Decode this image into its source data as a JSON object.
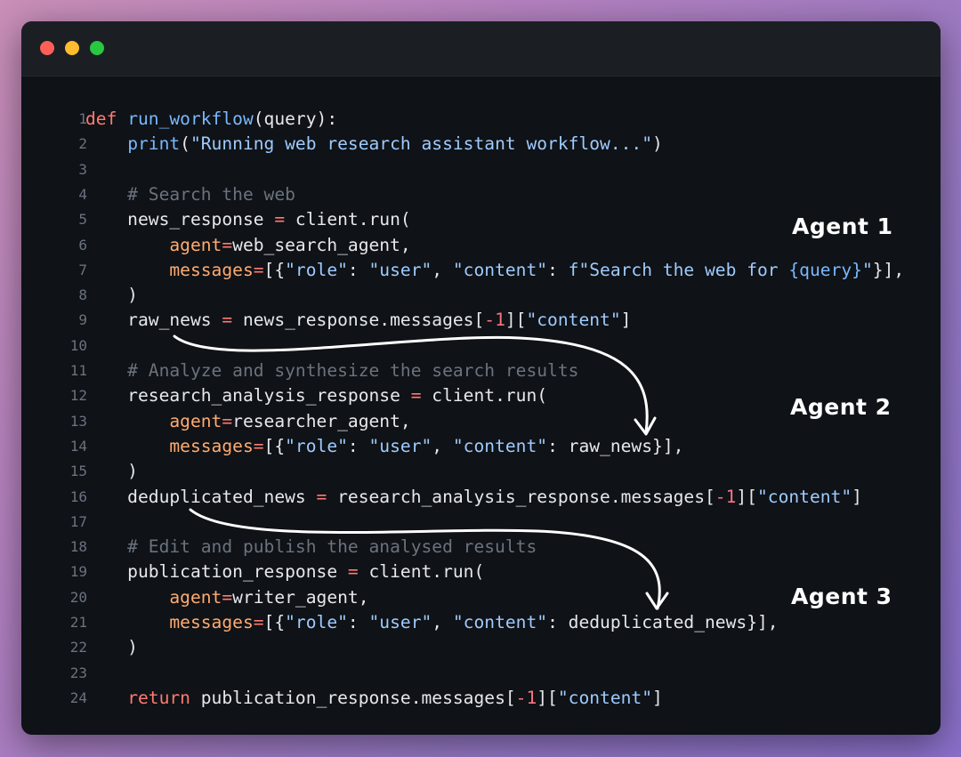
{
  "window": {
    "controls": [
      "close",
      "minimize",
      "maximize"
    ]
  },
  "code_lines": [
    [
      {
        "t": "def ",
        "c": "kw"
      },
      {
        "t": "run_workflow",
        "c": "fn"
      },
      {
        "t": "(query):",
        "c": "pl"
      }
    ],
    [
      {
        "t": "    ",
        "c": "pl"
      },
      {
        "t": "print",
        "c": "fn"
      },
      {
        "t": "(",
        "c": "pl"
      },
      {
        "t": "\"Running web research assistant workflow...\"",
        "c": "str"
      },
      {
        "t": ")",
        "c": "pl"
      }
    ],
    [],
    [
      {
        "t": "    # Search the web",
        "c": "com"
      }
    ],
    [
      {
        "t": "    news_response ",
        "c": "pl"
      },
      {
        "t": "=",
        "c": "op"
      },
      {
        "t": " client.run(",
        "c": "pl"
      }
    ],
    [
      {
        "t": "        ",
        "c": "pl"
      },
      {
        "t": "agent",
        "c": "arg"
      },
      {
        "t": "=",
        "c": "op"
      },
      {
        "t": "web_search_agent,",
        "c": "pl"
      }
    ],
    [
      {
        "t": "        ",
        "c": "pl"
      },
      {
        "t": "messages",
        "c": "arg"
      },
      {
        "t": "=",
        "c": "op"
      },
      {
        "t": "[{",
        "c": "pl"
      },
      {
        "t": "\"role\"",
        "c": "str"
      },
      {
        "t": ": ",
        "c": "pl"
      },
      {
        "t": "\"user\"",
        "c": "str"
      },
      {
        "t": ", ",
        "c": "pl"
      },
      {
        "t": "\"content\"",
        "c": "str"
      },
      {
        "t": ": ",
        "c": "pl"
      },
      {
        "t": "f\"Search the web for ",
        "c": "str"
      },
      {
        "t": "{query}",
        "c": "fn"
      },
      {
        "t": "\"",
        "c": "str"
      },
      {
        "t": "}],",
        "c": "pl"
      }
    ],
    [
      {
        "t": "    )",
        "c": "pl"
      }
    ],
    [
      {
        "t": "    raw_news ",
        "c": "pl"
      },
      {
        "t": "=",
        "c": "op"
      },
      {
        "t": " news_response.messages[",
        "c": "pl"
      },
      {
        "t": "-1",
        "c": "num"
      },
      {
        "t": "][",
        "c": "pl"
      },
      {
        "t": "\"content\"",
        "c": "str"
      },
      {
        "t": "]",
        "c": "pl"
      }
    ],
    [],
    [
      {
        "t": "    # Analyze and synthesize the search results",
        "c": "com"
      }
    ],
    [
      {
        "t": "    research_analysis_response ",
        "c": "pl"
      },
      {
        "t": "=",
        "c": "op"
      },
      {
        "t": " client.run(",
        "c": "pl"
      }
    ],
    [
      {
        "t": "        ",
        "c": "pl"
      },
      {
        "t": "agent",
        "c": "arg"
      },
      {
        "t": "=",
        "c": "op"
      },
      {
        "t": "researcher_agent,",
        "c": "pl"
      }
    ],
    [
      {
        "t": "        ",
        "c": "pl"
      },
      {
        "t": "messages",
        "c": "arg"
      },
      {
        "t": "=",
        "c": "op"
      },
      {
        "t": "[{",
        "c": "pl"
      },
      {
        "t": "\"role\"",
        "c": "str"
      },
      {
        "t": ": ",
        "c": "pl"
      },
      {
        "t": "\"user\"",
        "c": "str"
      },
      {
        "t": ", ",
        "c": "pl"
      },
      {
        "t": "\"content\"",
        "c": "str"
      },
      {
        "t": ": raw_news}],",
        "c": "pl"
      }
    ],
    [
      {
        "t": "    )",
        "c": "pl"
      }
    ],
    [
      {
        "t": "    deduplicated_news ",
        "c": "pl"
      },
      {
        "t": "=",
        "c": "op"
      },
      {
        "t": " research_analysis_response.messages[",
        "c": "pl"
      },
      {
        "t": "-1",
        "c": "num"
      },
      {
        "t": "][",
        "c": "pl"
      },
      {
        "t": "\"content\"",
        "c": "str"
      },
      {
        "t": "]",
        "c": "pl"
      }
    ],
    [],
    [
      {
        "t": "    # Edit and publish the analysed results",
        "c": "com"
      }
    ],
    [
      {
        "t": "    publication_response ",
        "c": "pl"
      },
      {
        "t": "=",
        "c": "op"
      },
      {
        "t": " client.run(",
        "c": "pl"
      }
    ],
    [
      {
        "t": "        ",
        "c": "pl"
      },
      {
        "t": "agent",
        "c": "arg"
      },
      {
        "t": "=",
        "c": "op"
      },
      {
        "t": "writer_agent,",
        "c": "pl"
      }
    ],
    [
      {
        "t": "        ",
        "c": "pl"
      },
      {
        "t": "messages",
        "c": "arg"
      },
      {
        "t": "=",
        "c": "op"
      },
      {
        "t": "[{",
        "c": "pl"
      },
      {
        "t": "\"role\"",
        "c": "str"
      },
      {
        "t": ": ",
        "c": "pl"
      },
      {
        "t": "\"user\"",
        "c": "str"
      },
      {
        "t": ", ",
        "c": "pl"
      },
      {
        "t": "\"content\"",
        "c": "str"
      },
      {
        "t": ": deduplicated_news}],",
        "c": "pl"
      }
    ],
    [
      {
        "t": "    )",
        "c": "pl"
      }
    ],
    [],
    [
      {
        "t": "    ",
        "c": "pl"
      },
      {
        "t": "return",
        "c": "kw"
      },
      {
        "t": " publication_response.messages[",
        "c": "pl"
      },
      {
        "t": "-1",
        "c": "num"
      },
      {
        "t": "][",
        "c": "pl"
      },
      {
        "t": "\"content\"",
        "c": "str"
      },
      {
        "t": "]",
        "c": "pl"
      }
    ]
  ],
  "agents": {
    "agent1": "Agent 1",
    "agent2": "Agent 2",
    "agent3": "Agent 3"
  }
}
